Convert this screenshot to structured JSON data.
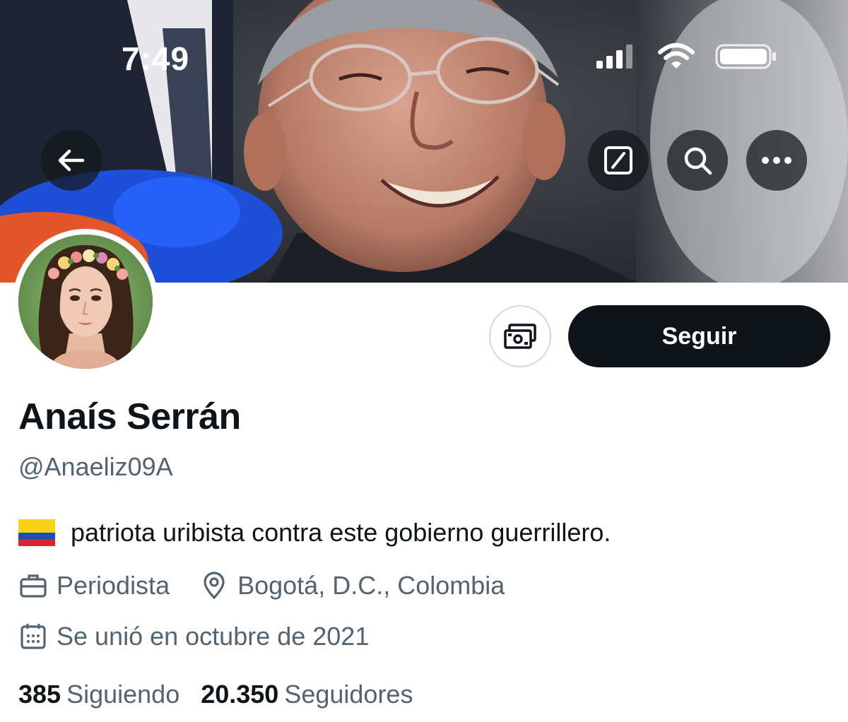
{
  "status_bar": {
    "time": "7:49",
    "signal_icon": "cellular-signal-icon",
    "wifi_icon": "wifi-icon",
    "battery_icon": "battery-icon"
  },
  "banner_buttons": {
    "back_icon": "arrow-left-icon",
    "grok_icon": "grok-icon",
    "search_icon": "search-icon",
    "more_icon": "more-horizontal-icon"
  },
  "profile": {
    "display_name": "Anaís Serrán",
    "handle": "@Anaeliz09A",
    "bio_text": "patriota uribista contra este gobierno guerrillero.",
    "bio_flag": "colombia-flag-icon",
    "profession": "Periodista",
    "location": "Bogotá, D.C., Colombia",
    "joined": "Se unió en octubre de 2021"
  },
  "actions": {
    "tip_icon": "money-tip-icon",
    "follow_label": "Seguir"
  },
  "stats": {
    "following_count": "385",
    "following_label": "Siguiendo",
    "followers_count": "20.350",
    "followers_label": "Seguidores"
  },
  "colors": {
    "text_primary": "#0f1419",
    "text_secondary": "#536471",
    "button_dark": "#0f1419",
    "border": "#cfd9de"
  }
}
